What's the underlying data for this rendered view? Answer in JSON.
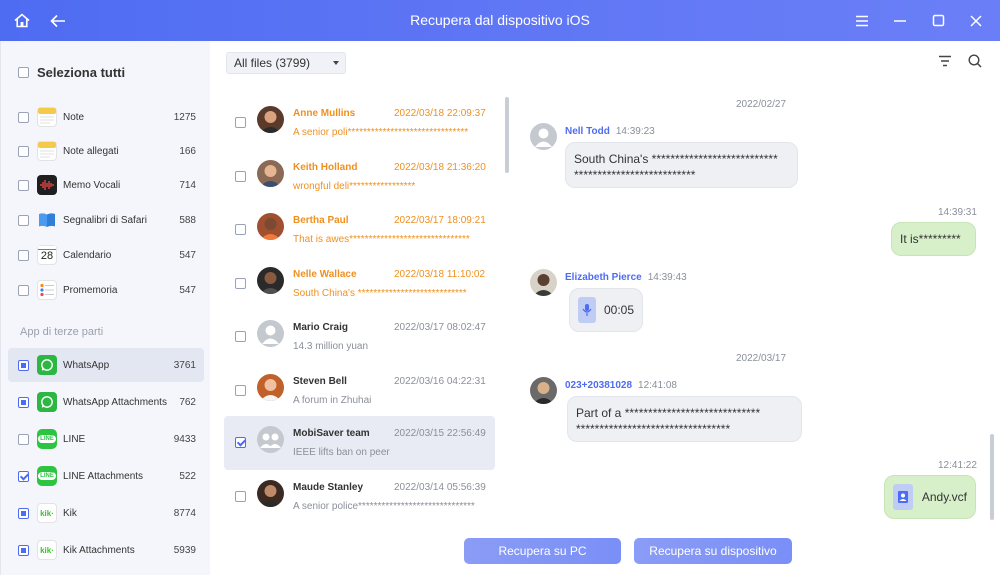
{
  "window": {
    "title": "Recupera dal dispositivo iOS"
  },
  "sidebar": {
    "select_all": "Seleziona tutti",
    "section_third_party": "App di terze parti",
    "items": [
      {
        "label": "Note",
        "count": "1275",
        "icon": "notes-icon"
      },
      {
        "label": "Note allegati",
        "count": "166",
        "icon": "notes-icon"
      },
      {
        "label": "Memo Vocali",
        "count": "714",
        "icon": "voice-memo-icon"
      },
      {
        "label": "Segnalibri di Safari",
        "count": "588",
        "icon": "book-icon"
      },
      {
        "label": "Calendario",
        "count": "547",
        "icon": "calendar-icon",
        "icon_text": "28"
      },
      {
        "label": "Promemoria",
        "count": "547",
        "icon": "reminders-icon"
      },
      {
        "label": "WhatsApp",
        "count": "3761",
        "icon": "whatsapp-icon"
      },
      {
        "label": "WhatsApp Attachments",
        "count": "762",
        "icon": "whatsapp-icon"
      },
      {
        "label": "LINE",
        "count": "9433",
        "icon": "line-icon",
        "icon_text": "LINE"
      },
      {
        "label": "LINE Attachments",
        "count": "522",
        "icon": "line-icon",
        "icon_text": "LINE"
      },
      {
        "label": "Kik",
        "count": "8774",
        "icon": "kik-icon",
        "icon_text": "kik·"
      },
      {
        "label": "Kik Attachments",
        "count": "5939",
        "icon": "kik-icon",
        "icon_text": "kik·"
      }
    ]
  },
  "filter": {
    "selected": "All files (3799)"
  },
  "contacts": [
    {
      "name": "Anne Mullins",
      "time": "2022/03/18 22:09:37",
      "preview": "A senior poli*******************************",
      "highlight": true
    },
    {
      "name": "Keith Holland",
      "time": "2022/03/18 21:36:20",
      "preview": "wrongful deli*****************",
      "highlight": true
    },
    {
      "name": "Bertha Paul",
      "time": "2022/03/17 18:09:21",
      "preview": "That is awes*******************************",
      "highlight": true
    },
    {
      "name": "Nelle Wallace",
      "time": "2022/03/18 11:10:02",
      "preview": "South China's ****************************",
      "highlight": true
    },
    {
      "name": "Mario Craig",
      "time": "2022/03/17 08:02:47",
      "preview": "14.3 million yuan",
      "highlight": false
    },
    {
      "name": "Steven Bell",
      "time": "2022/03/16 04:22:31",
      "preview": "A forum in Zhuhai",
      "highlight": false
    },
    {
      "name": "MobiSaver team",
      "time": "2022/03/15 22:56:49",
      "preview": "IEEE lifts ban on peer",
      "highlight": false
    },
    {
      "name": "Maude Stanley",
      "time": "2022/03/14 05:56:39",
      "preview": "A senior police******************************",
      "highlight": false
    }
  ],
  "chat": {
    "date1": "2022/02/27",
    "date2": "2022/03/17",
    "m1": {
      "sender": "Nell Todd",
      "time": "14:39:23",
      "line1": "South China's ***************************",
      "line2": "**************************"
    },
    "m2": {
      "time": "14:39:31",
      "text": "It is*********"
    },
    "m3": {
      "sender": "Elizabeth Pierce",
      "time": "14:39:43",
      "audio": "00:05"
    },
    "m4": {
      "sender": "023+20381028",
      "time": "12:41:08",
      "line1": "Part of a *****************************",
      "line2": "*********************************"
    },
    "m5": {
      "time": "12:41:22",
      "file": "Andy.vcf"
    }
  },
  "buttons": {
    "recover_pc": "Recupera su PC",
    "recover_device": "Recupera su dispositivo"
  }
}
